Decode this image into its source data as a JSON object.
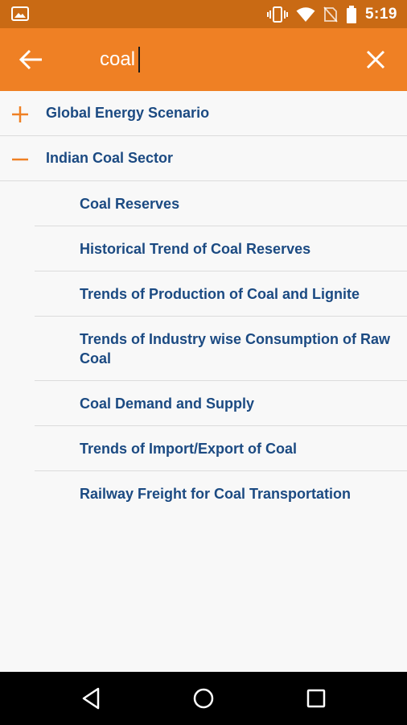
{
  "status_bar": {
    "time": "5:19",
    "icons": [
      "image-icon",
      "vibrate-icon",
      "wifi-icon",
      "no-sim-icon",
      "battery-icon"
    ]
  },
  "app_bar": {
    "search_value": "coal",
    "icons": [
      "back-arrow-icon",
      "clear-icon"
    ],
    "background": "#ef8024"
  },
  "list": {
    "groups": [
      {
        "label": "Global Energy Scenario",
        "state": "collapsed"
      },
      {
        "label": "Indian Coal Sector",
        "state": "expanded"
      }
    ],
    "items": [
      {
        "label": "Coal Reserves"
      },
      {
        "label": "Historical Trend of Coal Reserves"
      },
      {
        "label": "Trends of Production of Coal and Lignite"
      },
      {
        "label": "Trends of Industry wise Consumption of Raw Coal"
      },
      {
        "label": "Coal Demand and Supply"
      },
      {
        "label": "Trends of Import/Export of Coal"
      },
      {
        "label": "Railway Freight for Coal Transportation"
      }
    ]
  },
  "nav_bar": {
    "icons": [
      "back-triangle-icon",
      "home-circle-icon",
      "recents-square-icon"
    ]
  },
  "colors": {
    "accent": "#ef8024",
    "status_bar": "#c96a14",
    "text_primary": "#1b4a82"
  }
}
